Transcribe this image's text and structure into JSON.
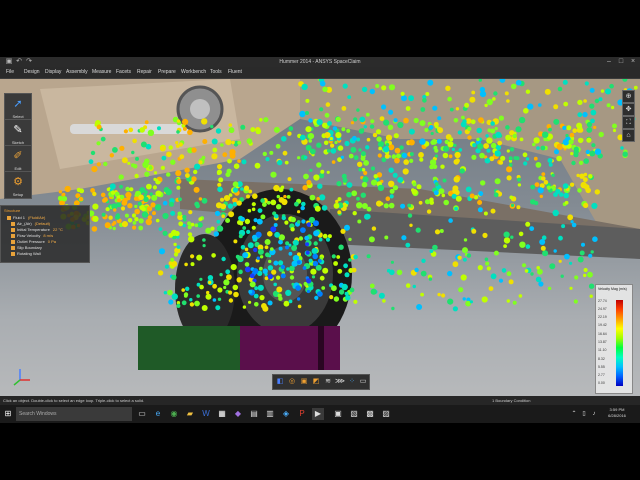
{
  "window": {
    "title": "Hummer 2014 - ANSYS SpaceClaim"
  },
  "menu": [
    "File",
    "Design",
    "Display",
    "Assembly",
    "Measure",
    "Facets",
    "Repair",
    "Prepare",
    "Workbench",
    "Tools",
    "Fluent"
  ],
  "tools": [
    {
      "label": "Select",
      "icon": "cursor-icon"
    },
    {
      "label": "Sketch",
      "icon": "pencil-icon"
    },
    {
      "label": "Edit",
      "icon": "brush-icon"
    },
    {
      "label": "Setup",
      "icon": "setup-icon"
    }
  ],
  "tree": {
    "header": "Structure",
    "items": [
      {
        "name": "Fluid 1",
        "value": "(Fluid/Air)"
      },
      {
        "name": "Air_(Air)",
        "value": "(Default)"
      },
      {
        "name": "Initial Temperature",
        "value": "22 °C"
      },
      {
        "name": "Flow Velocity",
        "value": "8 m/s"
      },
      {
        "name": "Outlet Pressure",
        "value": "0 Pa"
      },
      {
        "name": "Slip Boundary",
        "value": ""
      },
      {
        "name": "Rotating Wall",
        "value": ""
      }
    ]
  },
  "legend": {
    "title": "Velocity Mag (m/s)",
    "ticks": [
      "27.74",
      "24.97",
      "22.19",
      "19.42",
      "16.64",
      "13.87",
      "11.10",
      "8.32",
      "5.55",
      "2.77",
      "0.00"
    ]
  },
  "status": {
    "left": "Click an object. Double-click to select an edge loop. Triple-click to select a solid.",
    "right": "1 Boundary Condition"
  },
  "taskbar": {
    "search_placeholder": "Search Windows",
    "time": "3:59 PM",
    "date": "6/28/2016"
  },
  "colors": {
    "accent": "#f0a030",
    "window_bg": "#2b2b2b"
  }
}
